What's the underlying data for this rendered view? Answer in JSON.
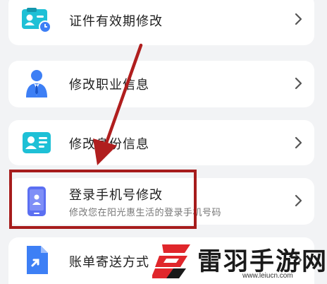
{
  "menu": {
    "items": [
      {
        "title": "证件有效期修改",
        "icon": "id-card-clock-icon"
      },
      {
        "title": "修改职业信息",
        "icon": "business-person-icon"
      },
      {
        "title": "修改身份信息",
        "icon": "id-card-icon"
      },
      {
        "title": "登录手机号修改",
        "subtitle": "修改您在阳光惠生活的登录手机号码",
        "icon": "phone-icon"
      },
      {
        "title": "账单寄送方式",
        "icon": "bill-document-icon"
      }
    ]
  },
  "annotation": {
    "highlight_color": "#a61c1c",
    "arrow_color": "#b01e1e"
  },
  "watermark": {
    "name": "雷羽手游网",
    "url": "www.leiucn.com"
  },
  "colors": {
    "icon_blue": "#3d7ff5",
    "icon_teal": "#23c6c8",
    "background": "#f2f3f5",
    "card": "#ffffff"
  }
}
